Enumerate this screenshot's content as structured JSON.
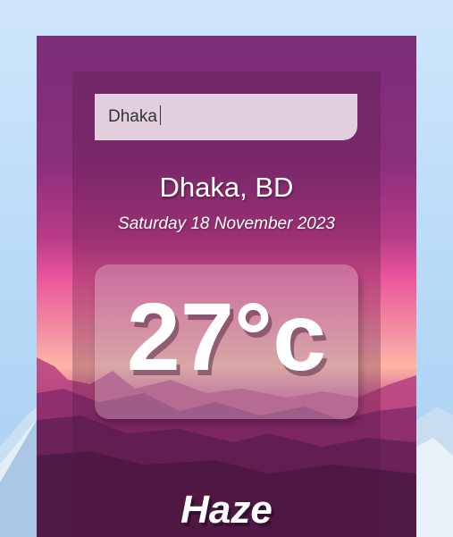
{
  "search": {
    "value": "Dhaka"
  },
  "location": {
    "name": "Dhaka, BD",
    "date": "Saturday 18 November 2023"
  },
  "weather": {
    "temperature": "27°c",
    "condition": "Haze"
  }
}
